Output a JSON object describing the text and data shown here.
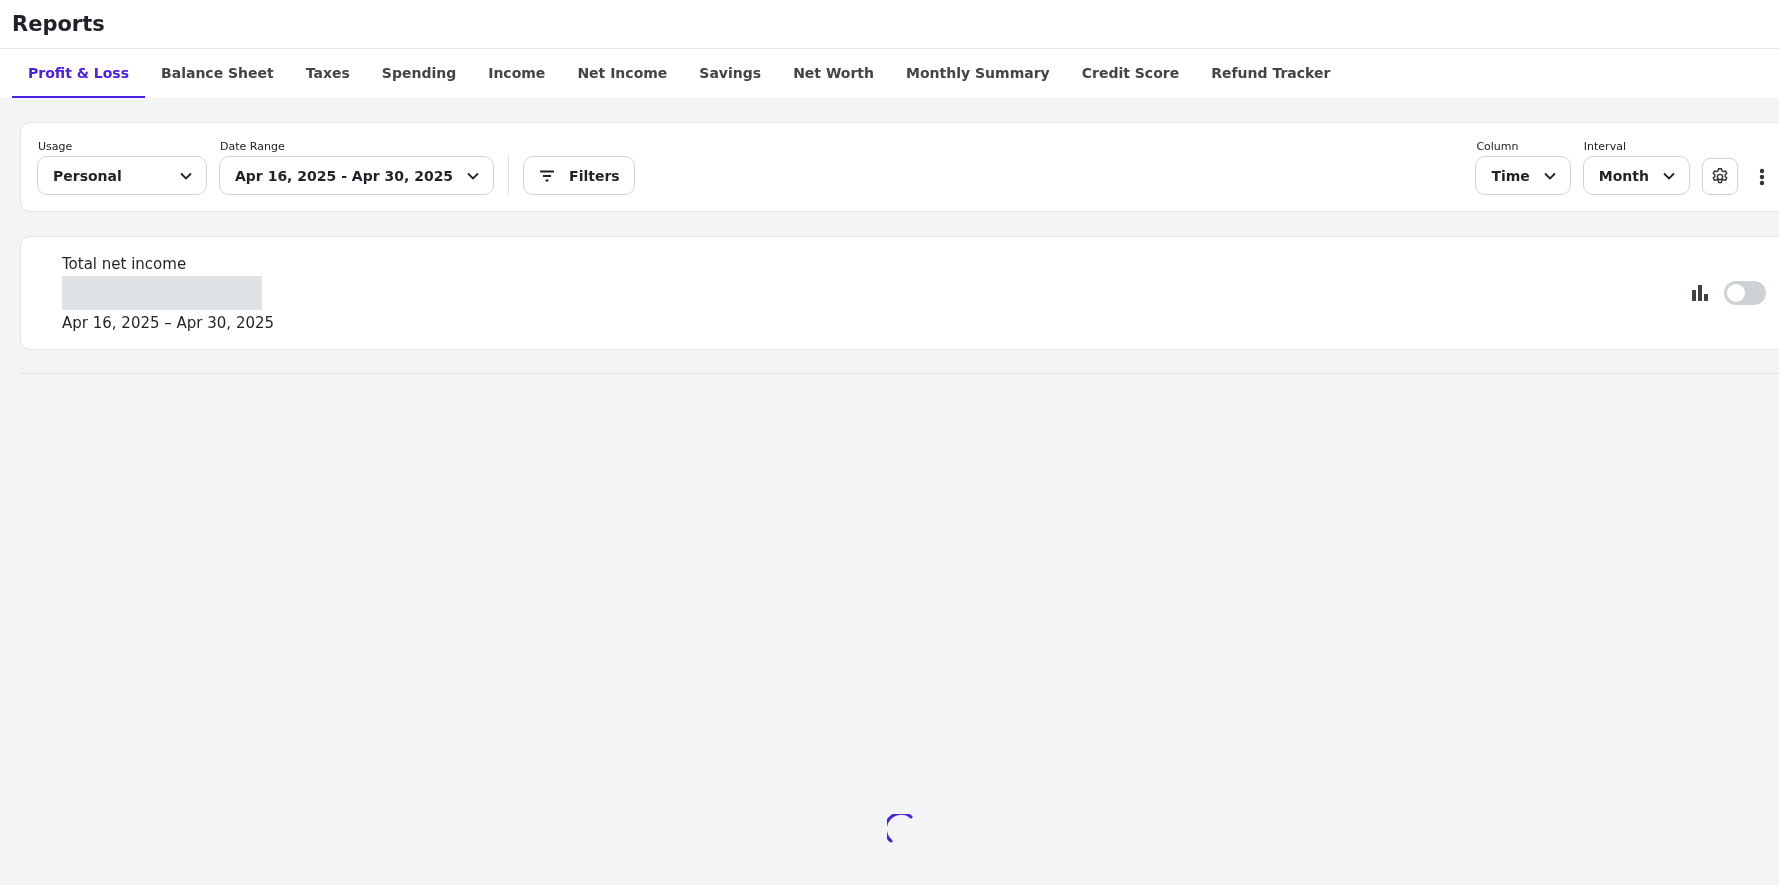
{
  "page": {
    "title": "Reports"
  },
  "tabs": [
    {
      "label": "Profit & Loss",
      "selected": true
    },
    {
      "label": "Balance Sheet",
      "selected": false
    },
    {
      "label": "Taxes",
      "selected": false
    },
    {
      "label": "Spending",
      "selected": false
    },
    {
      "label": "Income",
      "selected": false
    },
    {
      "label": "Net Income",
      "selected": false
    },
    {
      "label": "Savings",
      "selected": false
    },
    {
      "label": "Net Worth",
      "selected": false
    },
    {
      "label": "Monthly Summary",
      "selected": false
    },
    {
      "label": "Credit Score",
      "selected": false
    },
    {
      "label": "Refund Tracker",
      "selected": false
    }
  ],
  "filters": {
    "usage": {
      "label": "Usage",
      "value": "Personal"
    },
    "date_range": {
      "label": "Date Range",
      "value": "Apr 16, 2025 - Apr 30, 2025"
    },
    "filters_button": "Filters",
    "column": {
      "label": "Column",
      "value": "Time"
    },
    "interval": {
      "label": "Interval",
      "value": "Month"
    }
  },
  "summary": {
    "title": "Total net income",
    "period": "Apr 16, 2025 – Apr 30, 2025",
    "chart_toggle": {
      "on": false
    }
  }
}
